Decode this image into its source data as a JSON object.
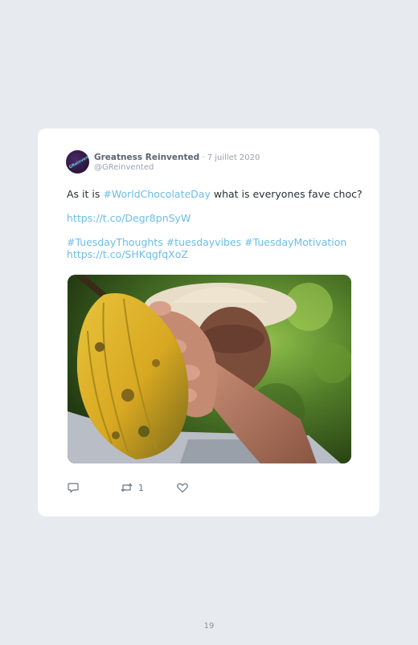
{
  "tweet": {
    "author_name": "Greatness Reinvented",
    "date": " · 7 juillet 2020",
    "handle": "@GReinvented",
    "avatar_text": "GReinvented",
    "line1_before": "As it is ",
    "line1_hashtag": "#WorldChocolateDay",
    "line1_after": " what is everyones fave choc?",
    "link1": "https://t.co/Degr8pnSyW",
    "hashtags_line": "#TuesdayThoughts #tuesdayvibes #TuesdayMotivation",
    "link2": "https://t.co/SHKqgfqXoZ",
    "retweet_count": "1"
  },
  "icons": {
    "reply": "reply-icon",
    "retweet": "retweet-icon",
    "like": "heart-icon"
  },
  "colors": {
    "background": "#e7eaee",
    "card": "#ffffff",
    "link": "#6cbde8"
  },
  "page_number": "19"
}
